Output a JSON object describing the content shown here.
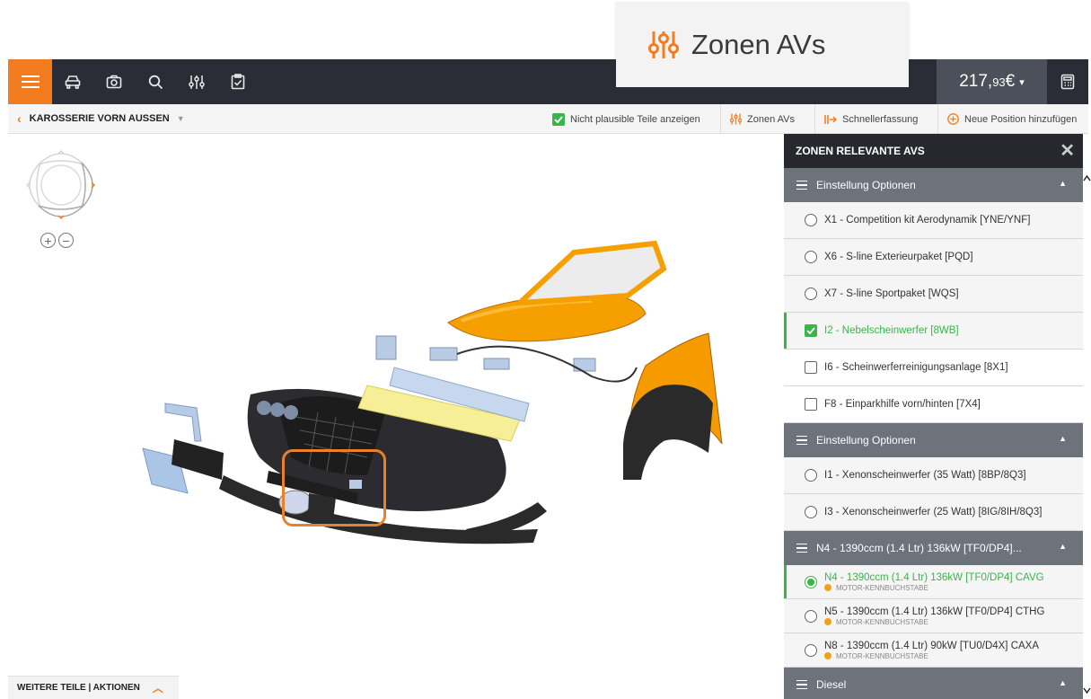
{
  "callout": {
    "label": "Zonen AVs"
  },
  "topbar": {
    "price_main": "217,",
    "price_cents": "93",
    "price_currency": " €",
    "price_caret": "▾"
  },
  "toolbar": {
    "breadcrumb": "KAROSSERIE VORN AUSSEN",
    "show_implausible": "Nicht plausible Teile anzeigen",
    "zones": "Zonen AVs",
    "quick_entry": "Schnellerfassung",
    "add_position": "Neue Position hinzufügen"
  },
  "viewer": {
    "footer_label": "WEITERE TEILE | AKTIONEN"
  },
  "panel": {
    "title": "ZONEN RELEVANTE AVS",
    "groups": [
      {
        "label": "Einstellung Optionen",
        "options": [
          {
            "label": "X1 - Competition kit Aerodynamik [YNE/YNF]",
            "control": "radio",
            "checked": false
          },
          {
            "label": "X6 - S-line Exterieurpaket [PQD]",
            "control": "radio",
            "checked": false
          },
          {
            "label": "X7 - S-line Sportpaket [WQS]",
            "control": "radio",
            "checked": false
          },
          {
            "label": "I2 - Nebelscheinwerfer [8WB]",
            "control": "checkbox",
            "checked": true
          },
          {
            "label": "I6 - Scheinwerferreinigungsanlage [8X1]",
            "control": "checkbox",
            "checked": false
          },
          {
            "label": "F8 - Einparkhilfe vorn/hinten [7X4]",
            "control": "checkbox",
            "checked": false
          }
        ]
      },
      {
        "label": "Einstellung Optionen",
        "options": [
          {
            "label": "I1 - Xenonscheinwerfer (35 Watt) [8BP/8Q3]",
            "control": "radio",
            "checked": false
          },
          {
            "label": "I3 - Xenonscheinwerfer (25 Watt) [8IG/8IH/8Q3]",
            "control": "radio",
            "checked": false
          }
        ]
      },
      {
        "label": "N4 - 1390ccm (1.4 Ltr) 136kW [TF0/DP4]...",
        "options": [
          {
            "label": "N4 - 1390ccm (1.4 Ltr) 136kW [TF0/DP4] CAVG",
            "sub": "MOTOR-KENNBUCHSTABE",
            "checked": true
          },
          {
            "label": "N5 - 1390ccm (1.4 Ltr) 136kW [TF0/DP4] CTHG",
            "sub": "MOTOR-KENNBUCHSTABE",
            "checked": false
          },
          {
            "label": "N8 - 1390ccm (1.4 Ltr) 90kW [TU0/D4X] CAXA",
            "sub": "MOTOR-KENNBUCHSTABE",
            "checked": false
          }
        ]
      },
      {
        "label": "Diesel",
        "options": []
      }
    ]
  },
  "colors": {
    "accent": "#f47c20",
    "topbar": "#2a2d36",
    "panel_header": "#26282e",
    "group_header": "#6d737b",
    "selected": "#3bb54a",
    "car_paint": "#f5a000"
  }
}
